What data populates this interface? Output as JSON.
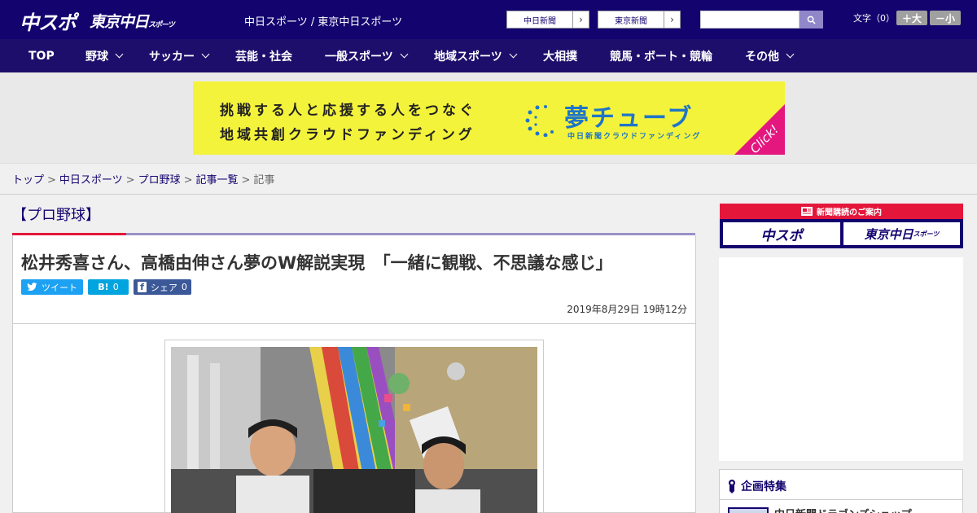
{
  "header": {
    "logo_chuspo": "中スポ",
    "logo_tokyo_main": "東京中日",
    "logo_tokyo_suffix": "スポーツ",
    "site_names": "中日スポーツ / 東京中日スポーツ",
    "paper_links": [
      {
        "label": "中日新聞"
      },
      {
        "label": "東京新聞"
      }
    ],
    "search": {
      "value": "",
      "placeholder": ""
    },
    "font_size_label": "文字（0）",
    "font_plus": "＋大",
    "font_minus": "－小"
  },
  "nav": {
    "items": [
      {
        "label": "TOP"
      },
      {
        "label": "野球"
      },
      {
        "label": "サッカー"
      },
      {
        "label": "芸能・社会"
      },
      {
        "label": "一般スポーツ"
      },
      {
        "label": "地域スポーツ"
      },
      {
        "label": "大相撲"
      },
      {
        "label": "競馬・ボート・競輪"
      },
      {
        "label": "その他"
      }
    ]
  },
  "ad_banner": {
    "line1": "挑戦する人と応援する人をつなぐ",
    "line2": "地域共創クラウドファンディング",
    "brand": "夢チューブ",
    "brand_sub": "中日新聞クラウドファンディング",
    "cta": "Click!",
    "colors": {
      "background": "#f4f33b",
      "brand": "#1f75c8",
      "corner": "#e4177f"
    }
  },
  "breadcrumb": {
    "items": [
      "トップ",
      "中日スポーツ",
      "プロ野球",
      "記事一覧"
    ],
    "current": "記事",
    "separator": ">"
  },
  "article": {
    "category": "【プロ野球】",
    "headline": "松井秀喜さん、高橋由伸さん夢のW解説実現　「一緒に観戦、不思議な感じ」",
    "share": {
      "tweet": "ツイート",
      "hatena_icon": "B!",
      "hatena_count": "0",
      "facebook_icon": "f",
      "facebook_label": "シェア",
      "facebook_count": "0"
    },
    "date": "2019年8月29日 19時12分"
  },
  "sidebar": {
    "subscription_title": "新聞購読のご案内",
    "subscription_logos": [
      "中スポ",
      "東京中日"
    ],
    "subscription_logo_suffix": "スポーツ",
    "feature_title": "企画特集",
    "feature_item": "中日新聞ドラゴンズショップ"
  },
  "colors": {
    "brand_navy": "#13036f",
    "nav_bg": "#1e0e6b",
    "accent_red": "#e4173b",
    "twitter": "#1da1f2",
    "hatena": "#00a4de",
    "facebook": "#3b5998"
  }
}
